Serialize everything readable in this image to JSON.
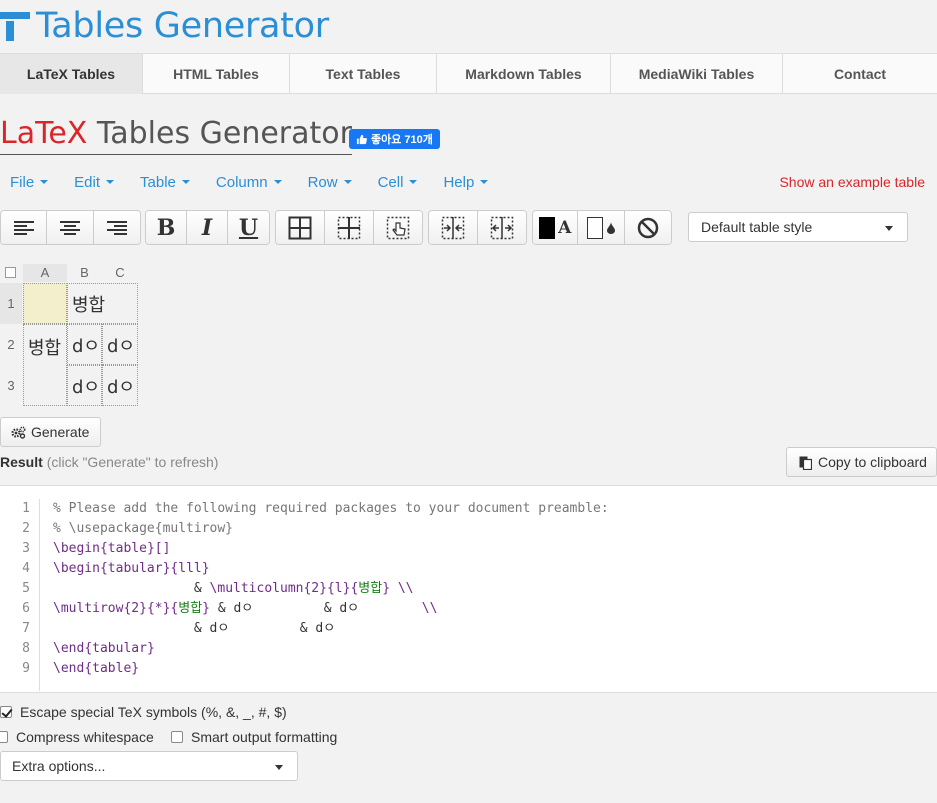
{
  "brand": {
    "title": "Tables Generator"
  },
  "tabs": [
    {
      "label": "LaTeX Tables",
      "active": true
    },
    {
      "label": "HTML Tables"
    },
    {
      "label": "Text Tables"
    },
    {
      "label": "Markdown Tables"
    },
    {
      "label": "MediaWiki Tables"
    },
    {
      "label": "Contact"
    }
  ],
  "page": {
    "title_latex": "LaTeX",
    "title_rest": " Tables Generator",
    "like_label": "좋아요 710개"
  },
  "menu": {
    "items": [
      "File",
      "Edit",
      "Table",
      "Column",
      "Row",
      "Cell",
      "Help"
    ],
    "example_link": "Show an example table"
  },
  "toolbar": {
    "bold": "B",
    "italic": "I",
    "underline": "U",
    "text_color_letter": "A",
    "table_style": "Default table style"
  },
  "grid": {
    "columns": [
      "A",
      "B",
      "C"
    ],
    "rows": [
      "1",
      "2",
      "3"
    ],
    "cells": {
      "b1": "병합",
      "a23": "병합",
      "b2": "dㅇ",
      "c2": "dㅇ",
      "b3": "dㅇ",
      "c3": "dㅇ"
    }
  },
  "generate": {
    "label": "Generate"
  },
  "result": {
    "label": "Result",
    "hint": "(click \"Generate\" to refresh)",
    "copy_label": "Copy to clipboard"
  },
  "code": {
    "line_numbers": [
      "1",
      "2",
      "3",
      "4",
      "5",
      "6",
      "7",
      "8",
      "9"
    ],
    "lines": [
      "% Please add the following required packages to your document preamble:",
      "% \\usepackage{multirow}",
      "\\begin{table}[]",
      "\\begin{tabular}{lll}",
      "                  & \\multicolumn{2}{l}{병합} \\\\",
      "\\multirow{2}{*}{병합} & dㅇ         & dㅇ        \\\\",
      "                  & dㅇ         & dㅇ",
      "\\end{tabular}",
      "\\end{table}"
    ]
  },
  "options": {
    "escape": {
      "label": "Escape special TeX symbols (%, &, _, #, $)",
      "checked": true
    },
    "compress": {
      "label": "Compress whitespace",
      "checked": false
    },
    "smart": {
      "label": "Smart output formatting",
      "checked": false
    },
    "extra": "Extra options..."
  }
}
